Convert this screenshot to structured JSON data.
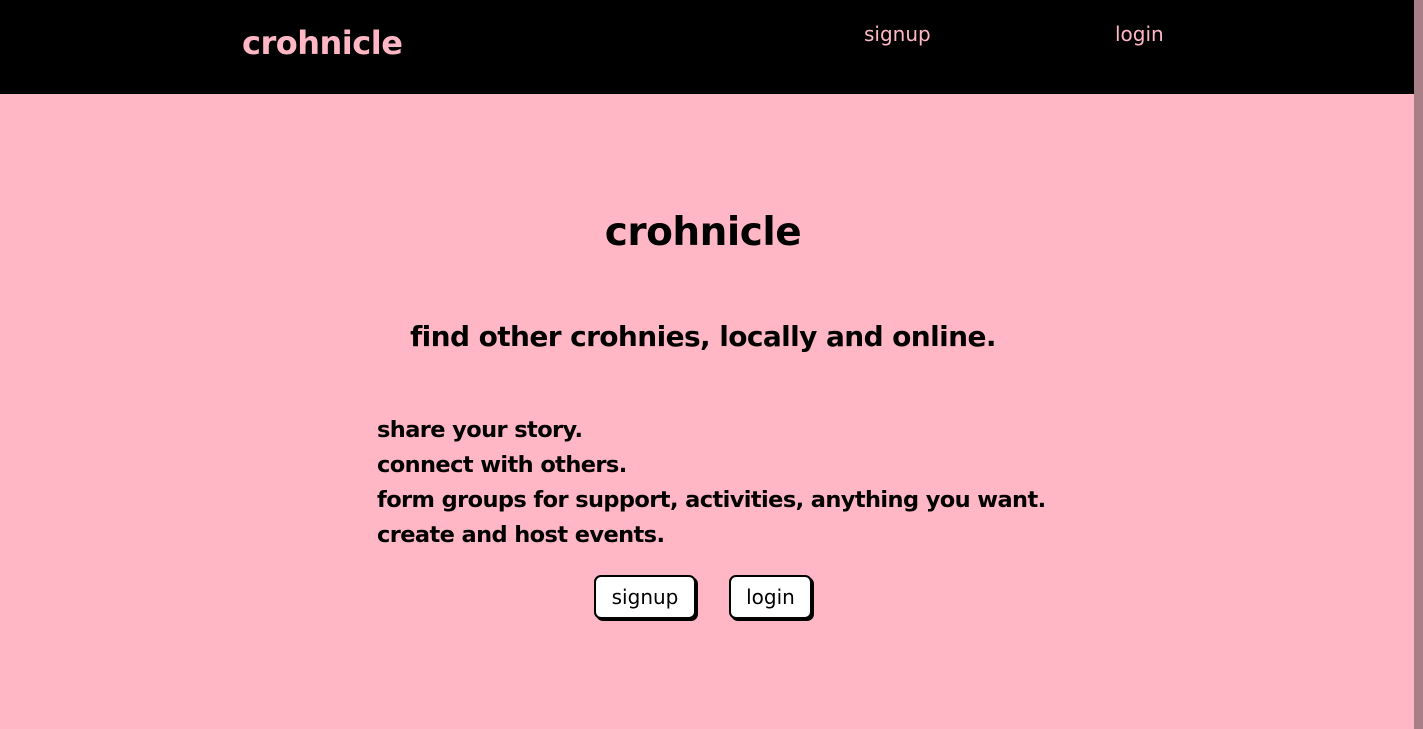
{
  "navbar": {
    "brand": "crohnicle",
    "links": [
      {
        "label": "signup"
      },
      {
        "label": "login"
      }
    ]
  },
  "hero": {
    "title": "crohnicle",
    "subtitle": "find other crohnies, locally and online.",
    "features": [
      "share your story.",
      "connect with others.",
      "form groups for support, activities, anything you want.",
      "create and host events."
    ],
    "buttons": [
      {
        "label": "signup"
      },
      {
        "label": "login"
      }
    ]
  },
  "colors": {
    "background": "#ffb7c5",
    "navbar": "#000000",
    "brand_accent": "#ffb7c5",
    "text": "#000000",
    "button_bg": "#ffffff"
  }
}
